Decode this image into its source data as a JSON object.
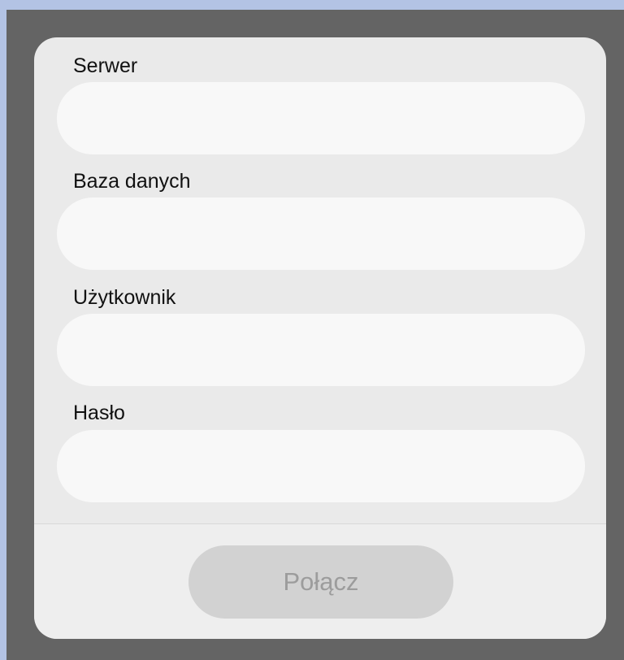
{
  "form": {
    "fields": [
      {
        "label": "Serwer",
        "value": "",
        "placeholder": ""
      },
      {
        "label": "Baza danych",
        "value": "",
        "placeholder": ""
      },
      {
        "label": "Użytkownik",
        "value": "",
        "placeholder": ""
      },
      {
        "label": "Hasło",
        "value": "",
        "placeholder": ""
      }
    ]
  },
  "footer": {
    "connect_label": "Połącz",
    "connect_enabled": false
  },
  "colors": {
    "backdrop": "#646464",
    "dialog": "#eaeaea",
    "input": "#f8f8f8",
    "button_disabled": "#d2d2d2",
    "button_text_disabled": "#9c9c9c"
  }
}
